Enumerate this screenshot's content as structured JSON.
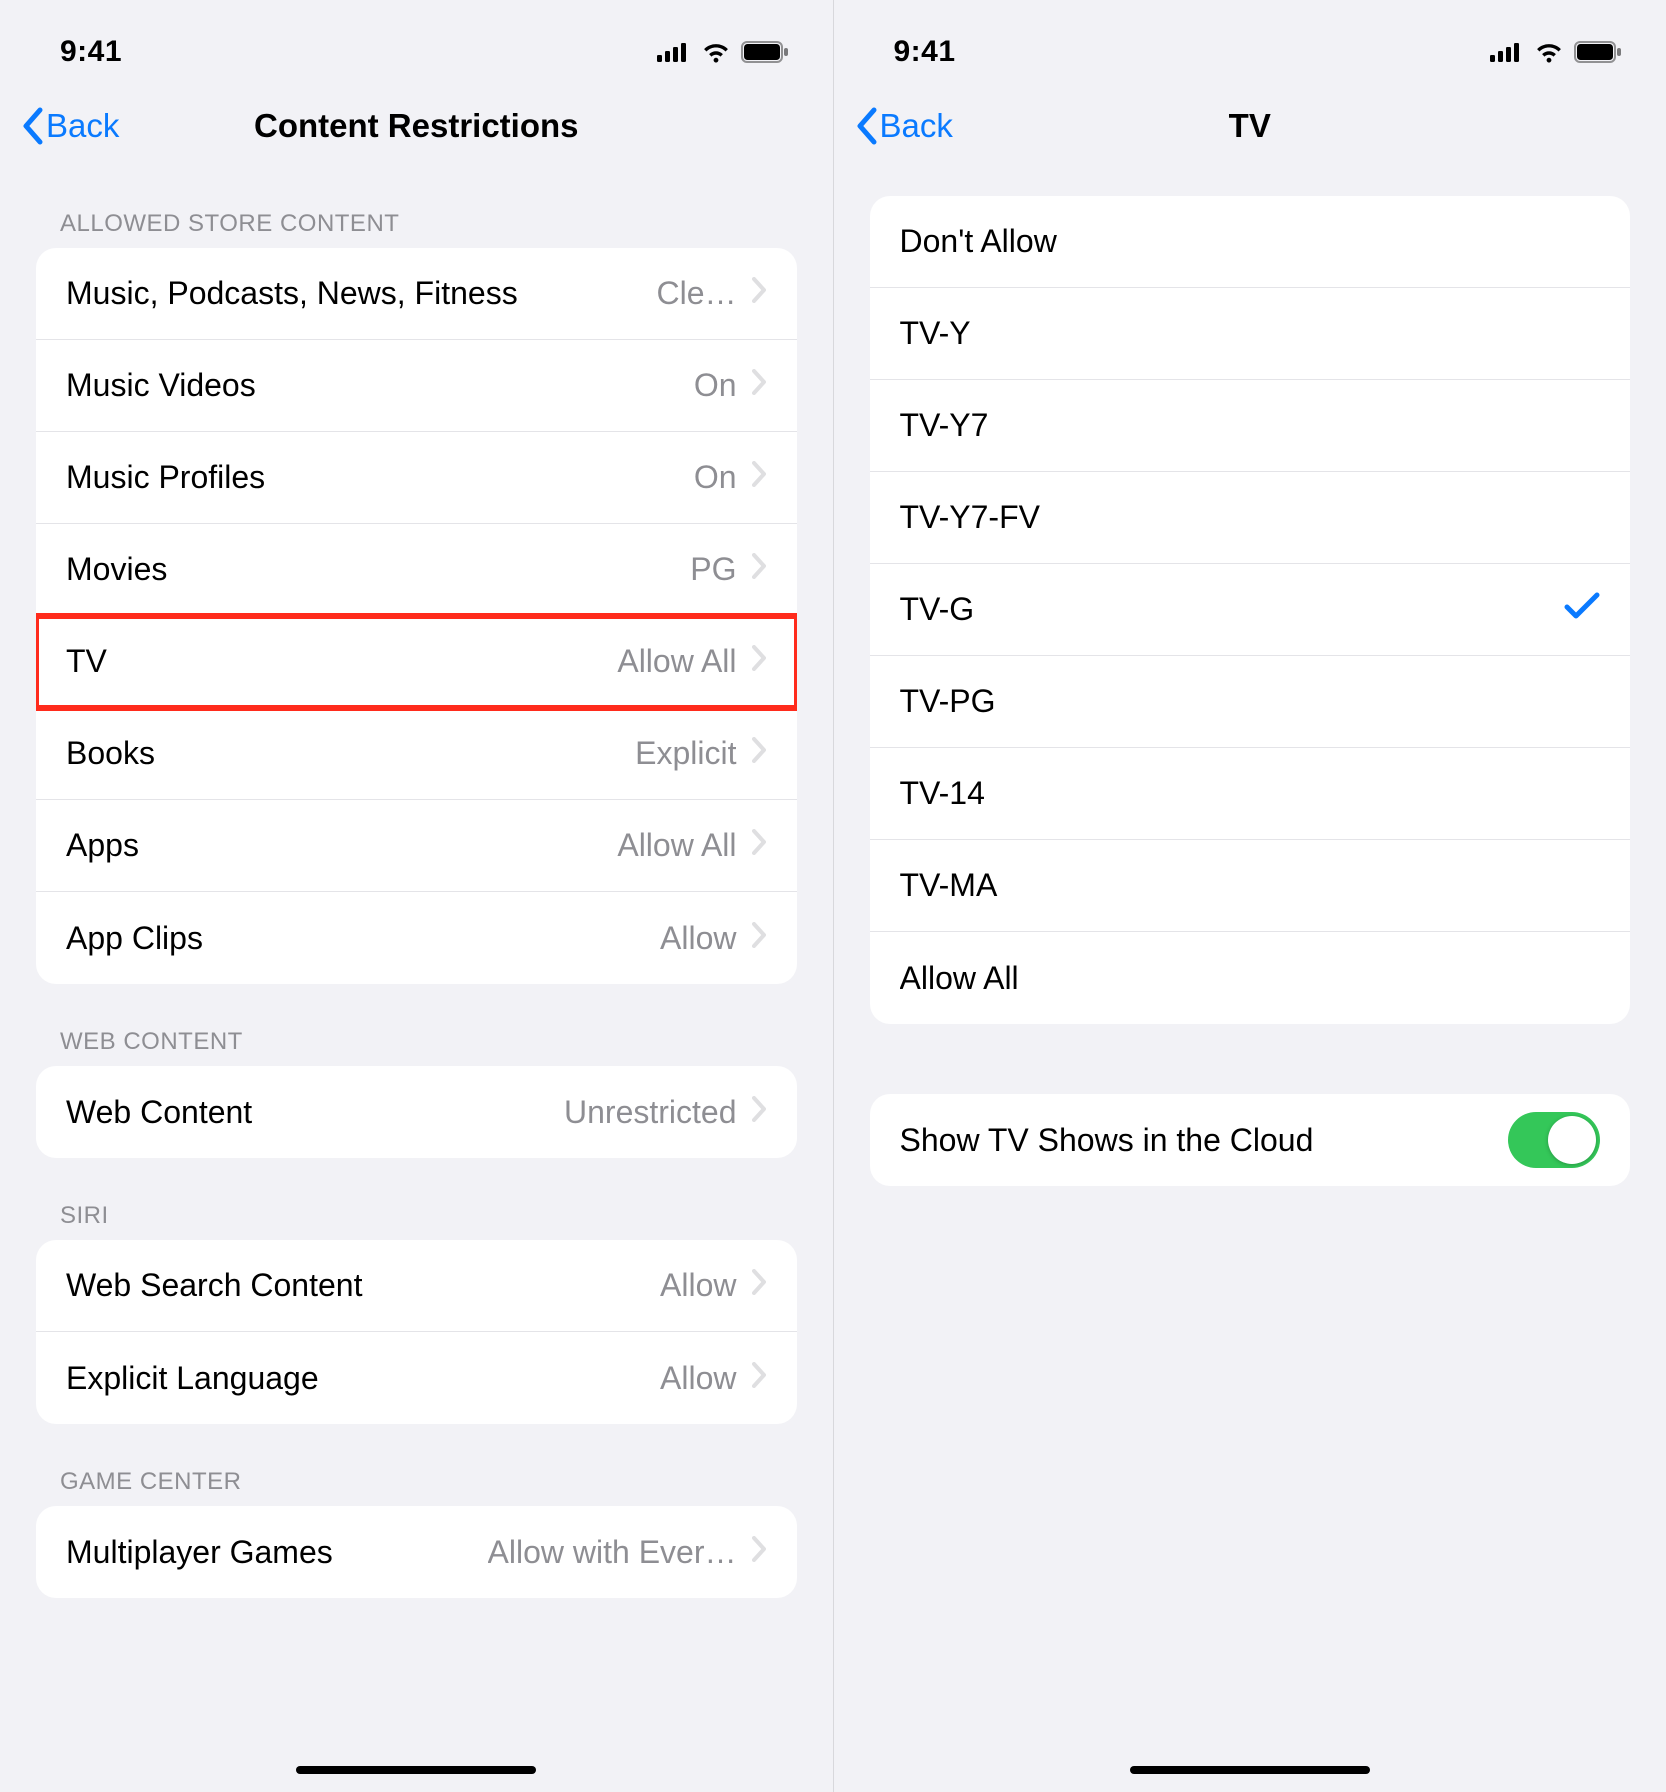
{
  "status": {
    "time": "9:41"
  },
  "left": {
    "nav": {
      "back": "Back",
      "title": "Content Restrictions"
    },
    "sections": [
      {
        "header": "ALLOWED STORE CONTENT",
        "rows": [
          {
            "label": "Music, Podcasts, News, Fitness",
            "value": "Cle…"
          },
          {
            "label": "Music Videos",
            "value": "On"
          },
          {
            "label": "Music Profiles",
            "value": "On"
          },
          {
            "label": "Movies",
            "value": "PG"
          },
          {
            "label": "TV",
            "value": "Allow All",
            "highlight": true
          },
          {
            "label": "Books",
            "value": "Explicit"
          },
          {
            "label": "Apps",
            "value": "Allow All"
          },
          {
            "label": "App Clips",
            "value": "Allow"
          }
        ]
      },
      {
        "header": "WEB CONTENT",
        "rows": [
          {
            "label": "Web Content",
            "value": "Unrestricted"
          }
        ]
      },
      {
        "header": "SIRI",
        "rows": [
          {
            "label": "Web Search Content",
            "value": "Allow"
          },
          {
            "label": "Explicit Language",
            "value": "Allow"
          }
        ]
      },
      {
        "header": "GAME CENTER",
        "rows": [
          {
            "label": "Multiplayer Games",
            "value": "Allow with Ever…"
          }
        ]
      }
    ]
  },
  "right": {
    "nav": {
      "back": "Back",
      "title": "TV"
    },
    "options": [
      {
        "label": "Don't Allow",
        "selected": false
      },
      {
        "label": "TV-Y",
        "selected": false
      },
      {
        "label": "TV-Y7",
        "selected": false
      },
      {
        "label": "TV-Y7-FV",
        "selected": false
      },
      {
        "label": "TV-G",
        "selected": true
      },
      {
        "label": "TV-PG",
        "selected": false
      },
      {
        "label": "TV-14",
        "selected": false
      },
      {
        "label": "TV-MA",
        "selected": false
      },
      {
        "label": "Allow All",
        "selected": false
      }
    ],
    "toggle": {
      "label": "Show TV Shows in the Cloud",
      "on": true
    }
  }
}
